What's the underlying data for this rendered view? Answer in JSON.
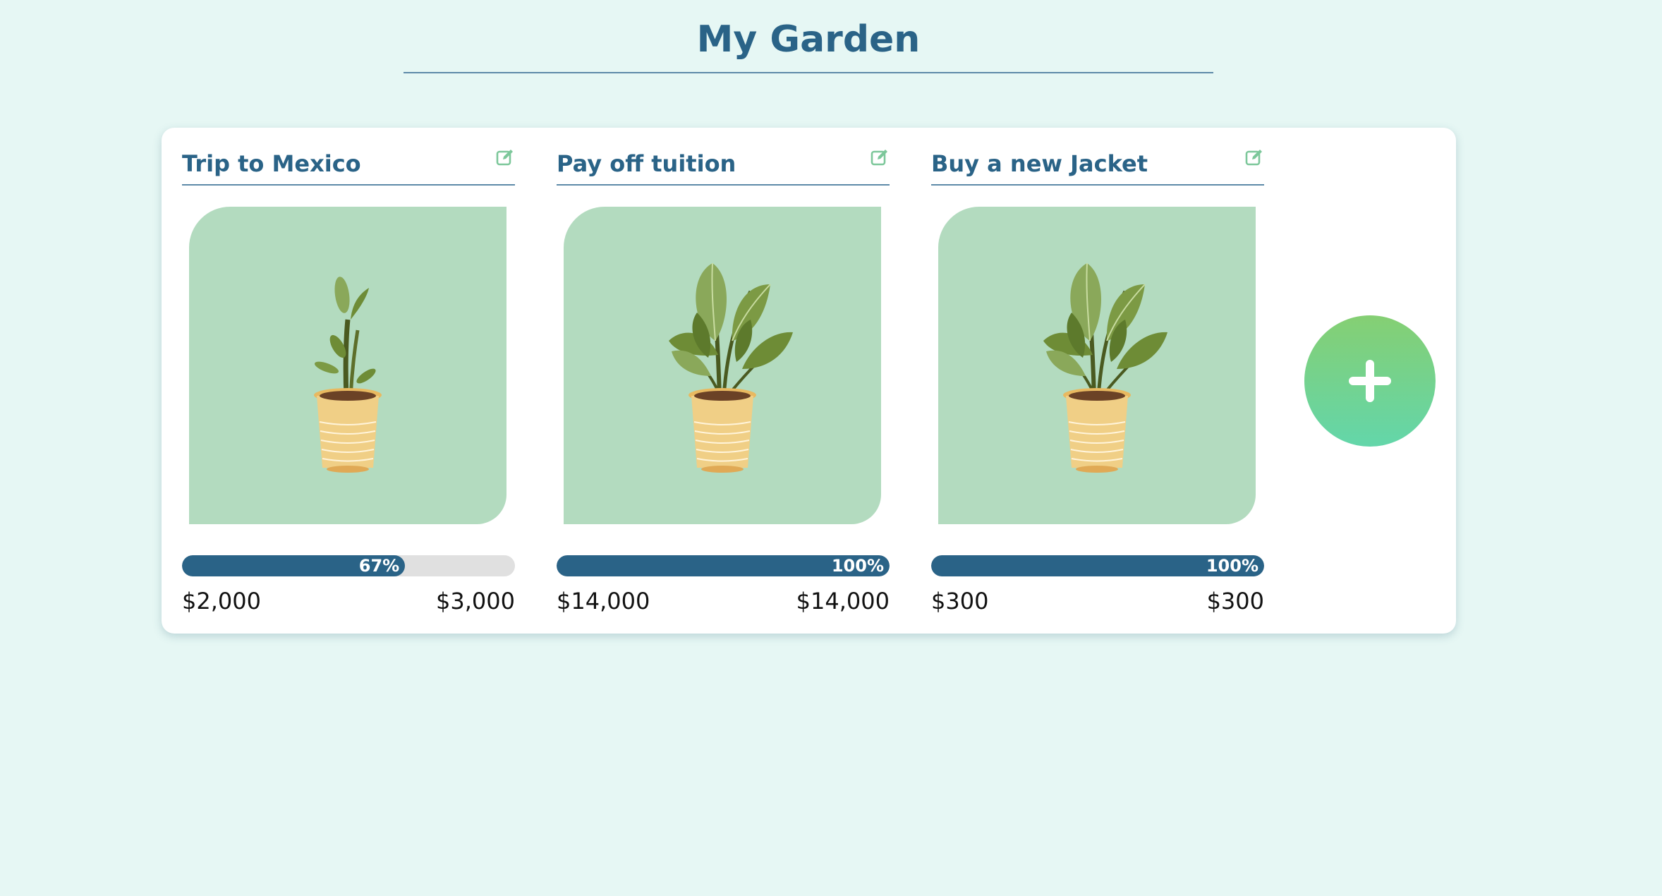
{
  "page": {
    "title": "My Garden"
  },
  "goals": [
    {
      "name": "Trip to Mexico",
      "progress_percent": 67,
      "progress_label": "67%",
      "saved": "$2,000",
      "target": "$3,000",
      "plant_stage": "small"
    },
    {
      "name": "Pay off tuition",
      "progress_percent": 100,
      "progress_label": "100%",
      "saved": "$14,000",
      "target": "$14,000",
      "plant_stage": "full"
    },
    {
      "name": "Buy a new Jacket",
      "progress_percent": 100,
      "progress_label": "100%",
      "saved": "$300",
      "target": "$300",
      "plant_stage": "full"
    }
  ],
  "icons": {
    "edit": "edit-icon",
    "add": "plus-icon",
    "plant": "potted-plant-icon"
  },
  "colors": {
    "background": "#e6f7f4",
    "heading": "#2a6387",
    "progress_fill": "#2a6387",
    "progress_track": "#e0e0e0",
    "plant_bg": "#b3dbbf",
    "edit_icon": "#7cc79a",
    "add_gradient_top": "#85cf73",
    "add_gradient_bottom": "#63d6aa"
  }
}
